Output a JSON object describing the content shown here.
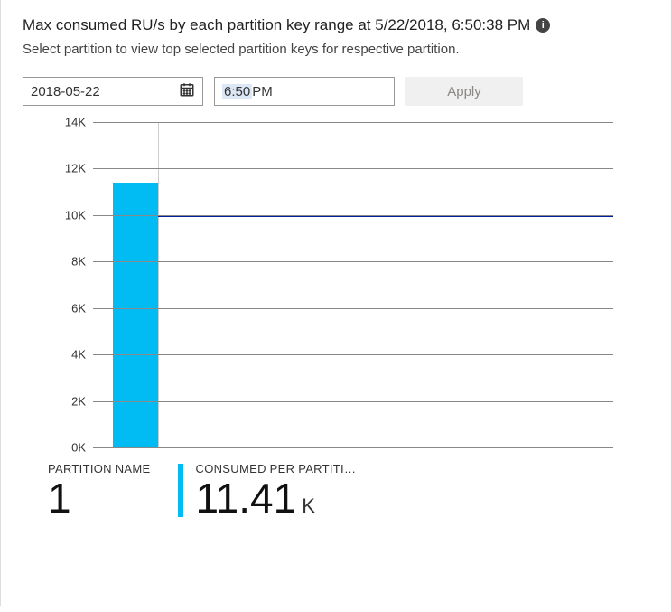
{
  "header": {
    "title": "Max consumed RU/s by each partition key range at 5/22/2018, 6:50:38 PM",
    "subtitle": "Select partition to view top selected partition keys for respective partition."
  },
  "controls": {
    "date_value": "2018-05-22",
    "time_value": "6:50",
    "time_suffix": " PM",
    "apply_label": "Apply"
  },
  "chart_data": {
    "type": "bar",
    "categories": [
      "1"
    ],
    "values": [
      11410
    ],
    "threshold": 10000,
    "ylim": [
      0,
      14000
    ],
    "yticks": [
      0,
      2000,
      4000,
      6000,
      8000,
      10000,
      12000,
      14000
    ],
    "ytick_labels": [
      "0K",
      "2K",
      "4K",
      "6K",
      "8K",
      "10K",
      "12K",
      "14K"
    ],
    "title": "",
    "xlabel": "",
    "ylabel": ""
  },
  "summary": {
    "partition_name_label": "PARTITION NAME",
    "partition_name_value": "1",
    "consumed_label": "CONSUMED PER PARTITI…",
    "consumed_value": "11.41",
    "consumed_suffix": "K"
  }
}
